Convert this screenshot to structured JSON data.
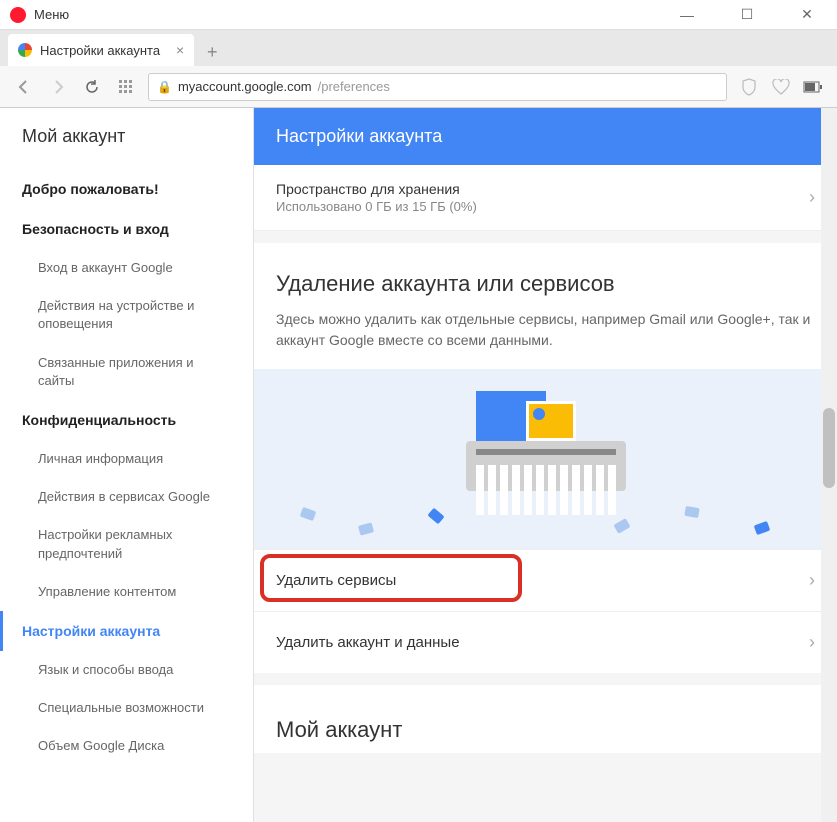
{
  "window": {
    "menu_label": "Меню",
    "minimize": "—",
    "maximize": "☐",
    "close": "✕"
  },
  "tab": {
    "title": "Настройки аккаунта"
  },
  "url": {
    "domain": "myaccount.google.com",
    "path": "/preferences"
  },
  "sidebar": {
    "title": "Мой аккаунт",
    "welcome": "Добро пожаловать!",
    "security_section": "Безопасность и вход",
    "security_items": [
      "Вход в аккаунт Google",
      "Действия на устройстве и оповещения",
      "Связанные приложения и сайты"
    ],
    "privacy_section": "Конфиденциальность",
    "privacy_items": [
      "Личная информация",
      "Действия в сервисах Google",
      "Настройки рекламных предпочтений",
      "Управление контентом"
    ],
    "settings_section": "Настройки аккаунта",
    "settings_items": [
      "Язык и способы ввода",
      "Специальные возможности",
      "Объем Google Диска"
    ]
  },
  "main": {
    "header": "Настройки аккаунта",
    "storage_title": "Пространство для хранения",
    "storage_sub": "Использовано 0 ГБ из 15 ГБ (0%)",
    "delete_heading": "Удаление аккаунта или сервисов",
    "delete_desc": "Здесь можно удалить как отдельные сервисы, например Gmail или Google+, так и аккаунт Google вместе со всеми данными.",
    "delete_services": "Удалить сервисы",
    "delete_account": "Удалить аккаунт и данные",
    "my_account": "Мой аккаунт"
  }
}
